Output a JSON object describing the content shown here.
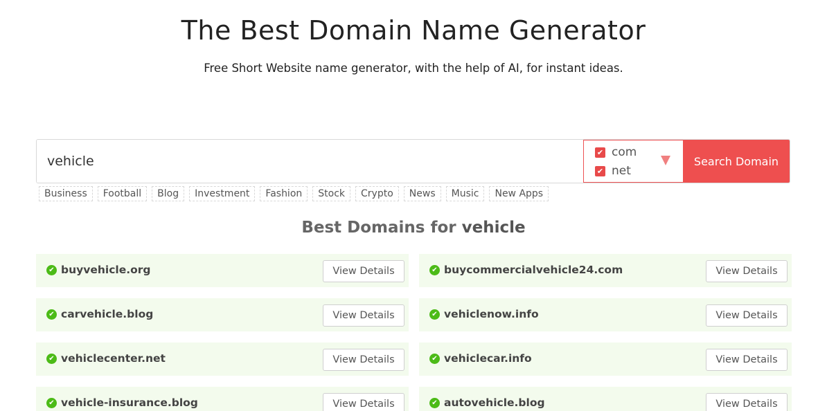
{
  "header": {
    "title": "The Best Domain Name Generator",
    "subtitle": "Free Short Website name generator, with the help of AI, for instant ideas."
  },
  "search": {
    "value": "vehicle",
    "tlds": [
      {
        "label": "com",
        "checked": true
      },
      {
        "label": "net",
        "checked": true
      }
    ],
    "button_label": "Search Domain"
  },
  "tags": [
    "Business",
    "Football",
    "Blog",
    "Investment",
    "Fashion",
    "Stock",
    "Crypto",
    "News",
    "Music",
    "New Apps"
  ],
  "results": {
    "heading_prefix": "Best Domains for",
    "heading_keyword": "vehicle",
    "view_label": "View Details",
    "items": [
      {
        "domain": "buyvehicle.org"
      },
      {
        "domain": "buycommercialvehicle24.com"
      },
      {
        "domain": "carvehicle.blog"
      },
      {
        "domain": "vehiclenow.info"
      },
      {
        "domain": "vehiclecenter.net"
      },
      {
        "domain": "vehiclecar.info"
      },
      {
        "domain": "vehicle-insurance.blog"
      },
      {
        "domain": "autovehicle.blog"
      }
    ]
  },
  "colors": {
    "accent": "#ee4f4f",
    "result_bg": "#f3fbed",
    "check_green": "#4cbb17"
  }
}
